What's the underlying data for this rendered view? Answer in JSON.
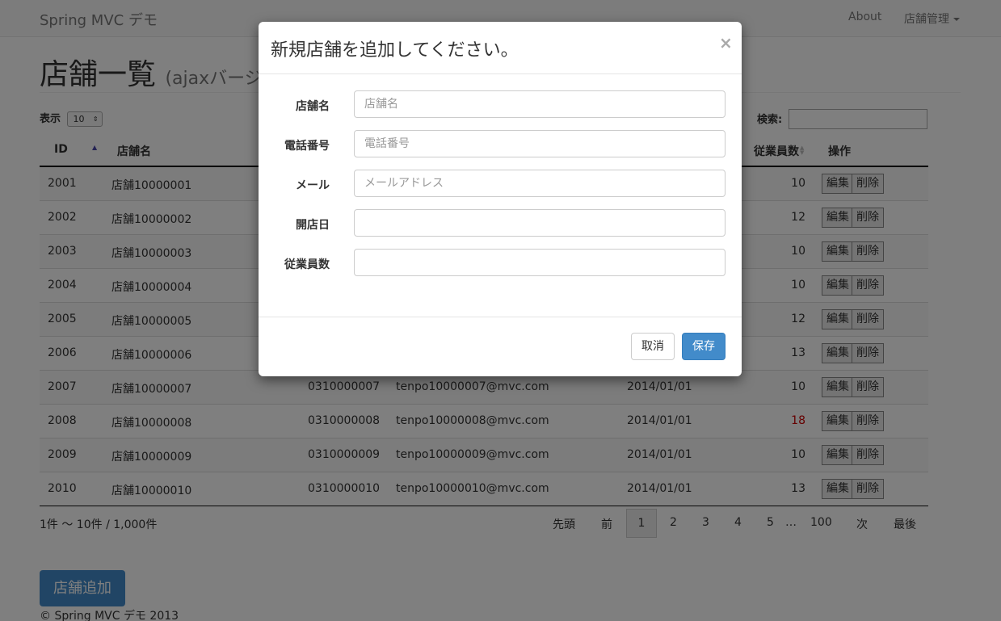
{
  "navbar": {
    "brand": "Spring MVC デモ",
    "about": "About",
    "manage": "店舗管理"
  },
  "header": {
    "title": "店舗一覧",
    "subtitle": "(ajaxバージ"
  },
  "table_controls": {
    "length_label": "表示",
    "length_value": "10",
    "search_label": "検索:"
  },
  "table": {
    "columns": {
      "id": "ID",
      "name": "店舗名",
      "employees": "従業員数",
      "actions": "操作"
    },
    "edit_label": "編集",
    "delete_label": "削除",
    "rows": [
      {
        "id": "2001",
        "name": "店舗10000001",
        "tel": "",
        "mail": "",
        "open": "",
        "emp": "10",
        "red": false
      },
      {
        "id": "2002",
        "name": "店舗10000002",
        "tel": "",
        "mail": "",
        "open": "",
        "emp": "12",
        "red": false
      },
      {
        "id": "2003",
        "name": "店舗10000003",
        "tel": "",
        "mail": "",
        "open": "",
        "emp": "10",
        "red": false
      },
      {
        "id": "2004",
        "name": "店舗10000004",
        "tel": "",
        "mail": "",
        "open": "",
        "emp": "10",
        "red": false
      },
      {
        "id": "2005",
        "name": "店舗10000005",
        "tel": "",
        "mail": "",
        "open": "",
        "emp": "12",
        "red": false
      },
      {
        "id": "2006",
        "name": "店舗10000006",
        "tel": "",
        "mail": "",
        "open": "",
        "emp": "13",
        "red": false
      },
      {
        "id": "2007",
        "name": "店舗10000007",
        "tel": "0310000007",
        "mail": "tenpo10000007@mvc.com",
        "open": "2014/01/01",
        "emp": "10",
        "red": false
      },
      {
        "id": "2008",
        "name": "店舗10000008",
        "tel": "0310000008",
        "mail": "tenpo10000008@mvc.com",
        "open": "2014/01/01",
        "emp": "18",
        "red": true
      },
      {
        "id": "2009",
        "name": "店舗10000009",
        "tel": "0310000009",
        "mail": "tenpo10000009@mvc.com",
        "open": "2014/01/01",
        "emp": "10",
        "red": false
      },
      {
        "id": "2010",
        "name": "店舗10000010",
        "tel": "0310000010",
        "mail": "tenpo10000010@mvc.com",
        "open": "2014/01/01",
        "emp": "13",
        "red": false
      }
    ]
  },
  "info": "1件 ～ 10件 / 1,000件",
  "pagination": {
    "first": "先頭",
    "prev": "前",
    "pages": [
      "1",
      "2",
      "3",
      "4",
      "5"
    ],
    "ellipsis": "…",
    "last_page": "100",
    "next": "次",
    "last": "最後",
    "current": "1"
  },
  "add_button": "店舗追加",
  "footer": "© Spring MVC デモ 2013",
  "modal": {
    "title": "新規店舗を追加してください。",
    "close": "×",
    "fields": [
      {
        "label": "店舗名",
        "placeholder": "店舗名"
      },
      {
        "label": "電話番号",
        "placeholder": "電話番号"
      },
      {
        "label": "メール",
        "placeholder": "メールアドレス"
      },
      {
        "label": "開店日",
        "placeholder": ""
      },
      {
        "label": "従業員数",
        "placeholder": ""
      }
    ],
    "cancel": "取消",
    "save": "保存"
  },
  "colors": {
    "primary": "#428bca",
    "highlight_red": "#cc0000",
    "sort_active": "#4a46a8"
  }
}
